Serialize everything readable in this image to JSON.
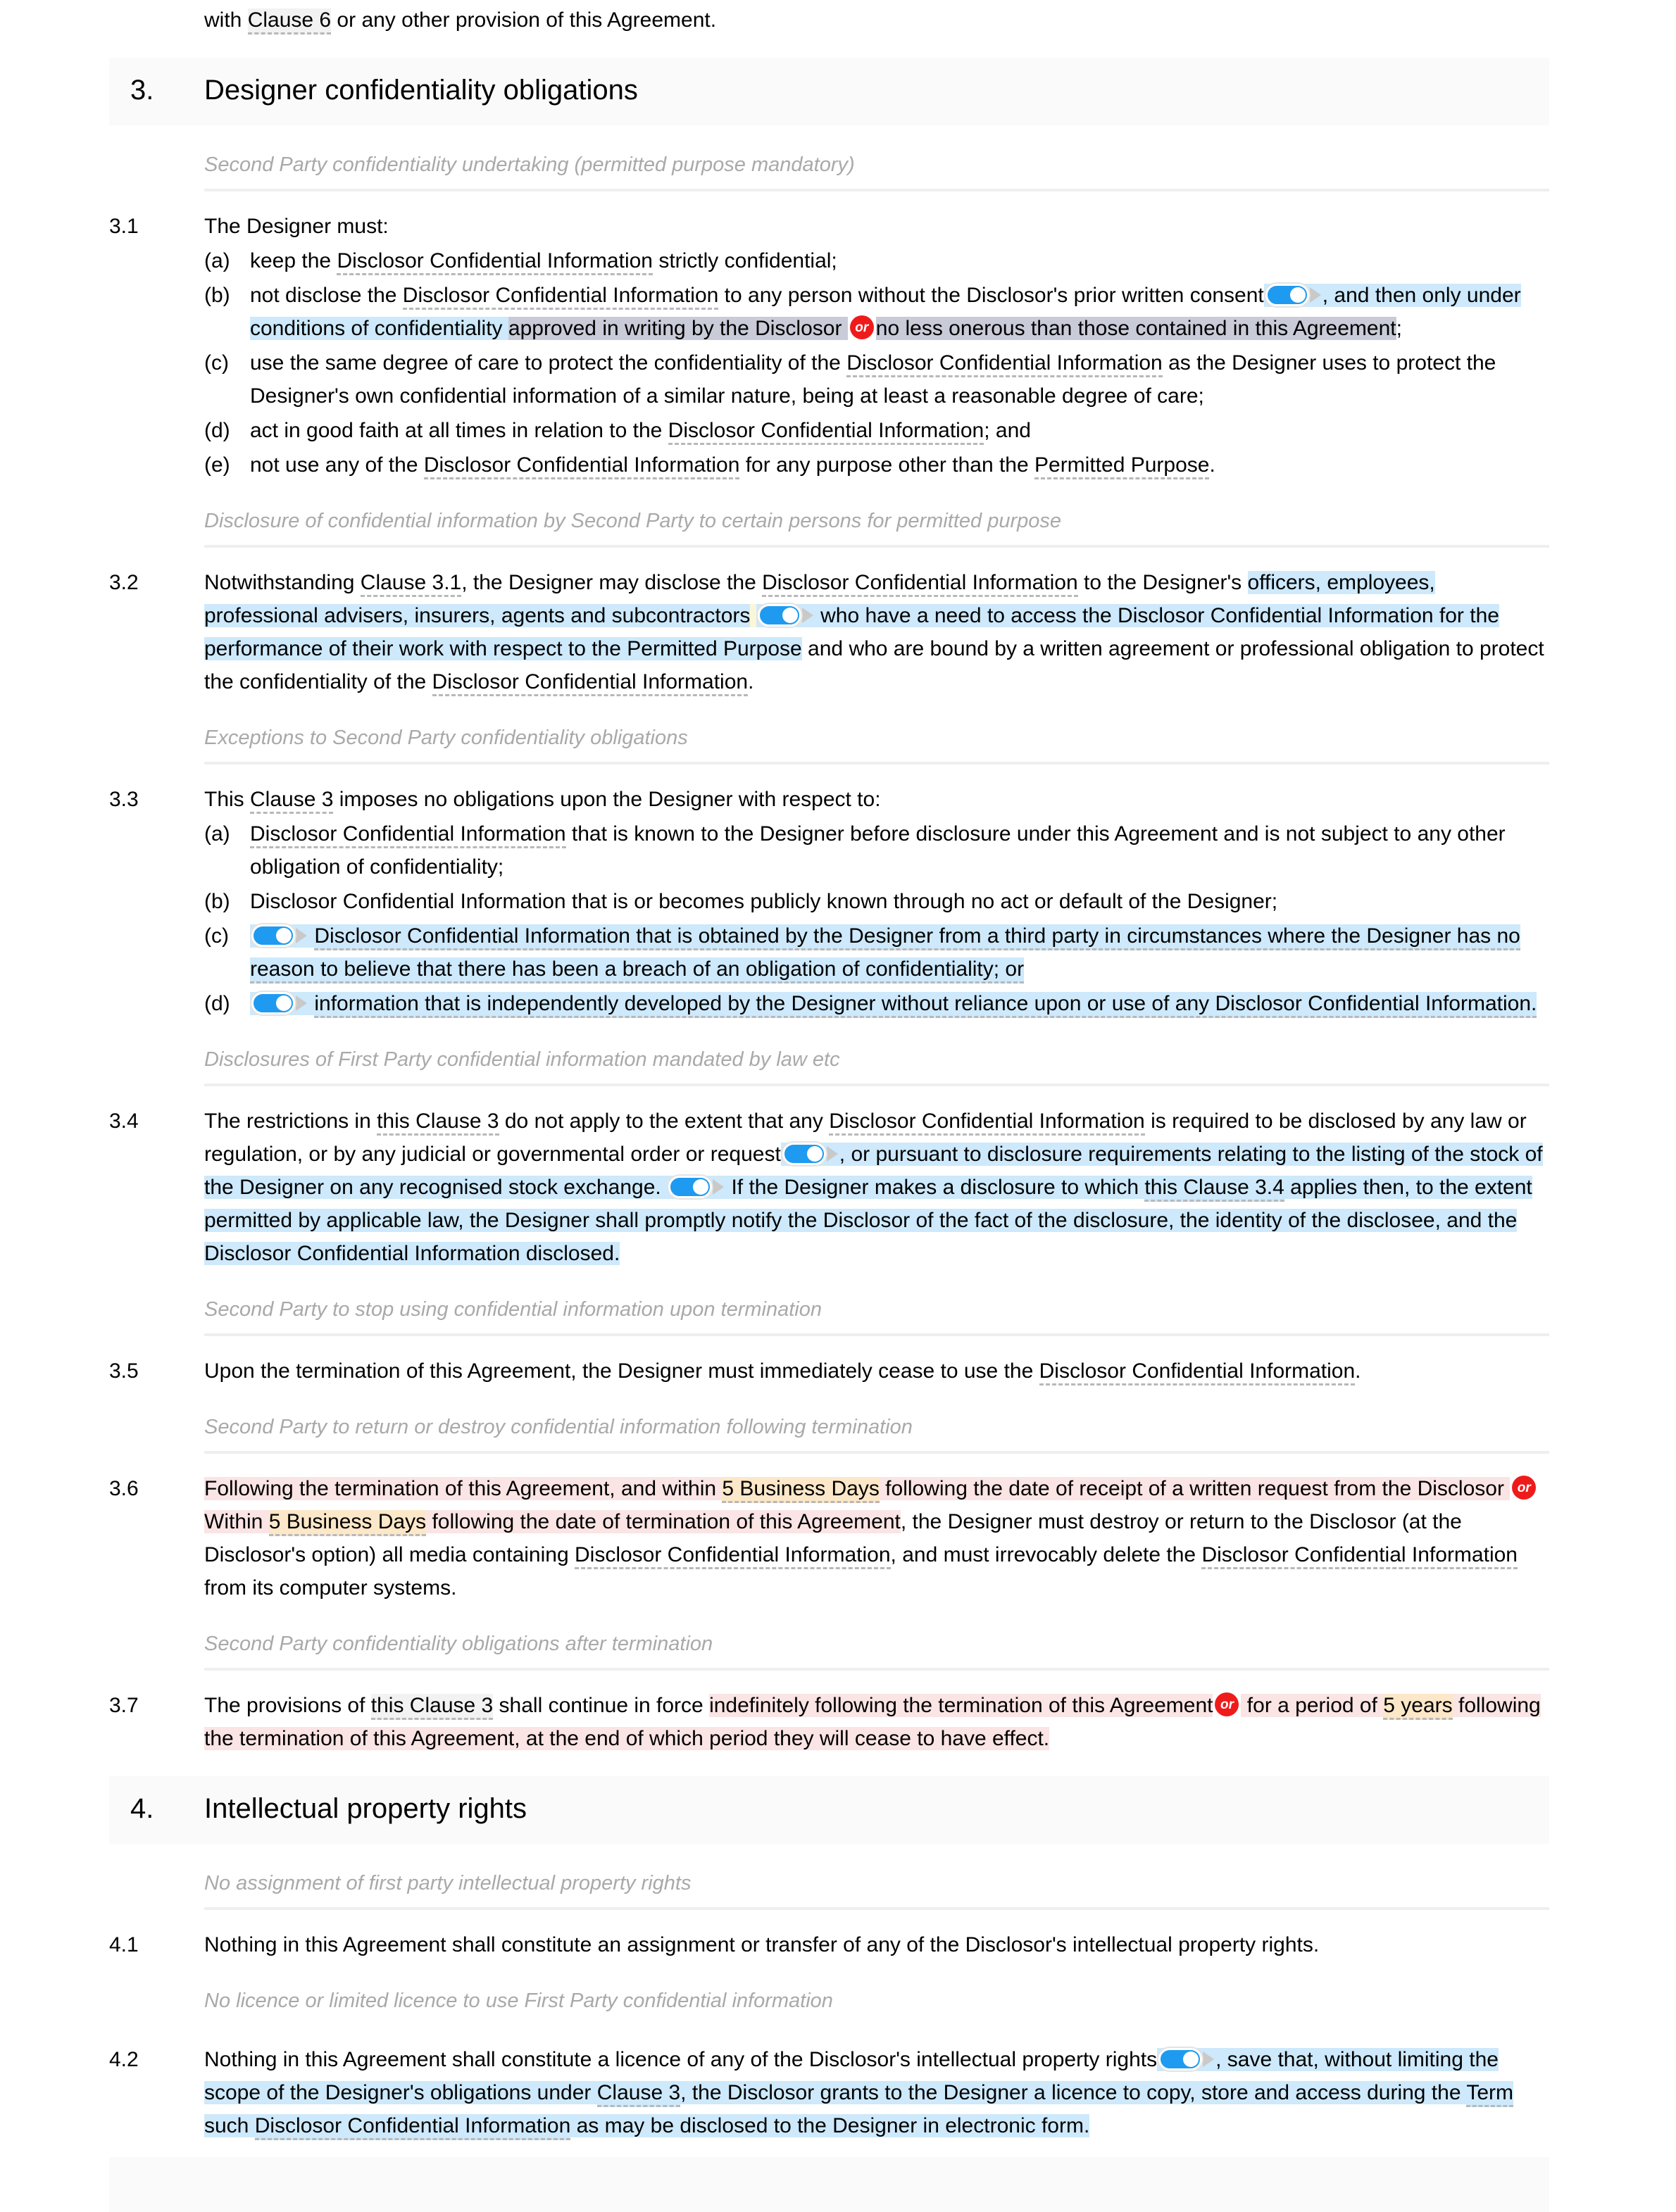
{
  "document": {
    "continued_text_before": "with Clause 6 or any other provision of this Agreement.",
    "continued_term": "Clause 6"
  },
  "colors": {
    "toggle_on": "#1e9bf0",
    "or_badge": "#ef1b1b",
    "highlight_blue": "#cde9fb",
    "highlight_lavender": "#c9cbd8",
    "highlight_grey": "#f2f2f2",
    "highlight_pink": "#fbe4e4",
    "highlight_orange": "#fce7c8",
    "highlight_cream": "#fcf6d8",
    "heading_band": "#fafafa",
    "caption_text": "#a9a9a9",
    "term_underline": "#b8b8b8"
  },
  "icons": {
    "toggle": "toggle-switch-on-icon",
    "or": "or-alternative-badge-icon",
    "triangle": "play-triangle-icon"
  },
  "sections": [
    {
      "number": "3.",
      "title": "Designer confidentiality obligations"
    },
    {
      "number": "4.",
      "title": "Intellectual property rights"
    }
  ],
  "captions": {
    "c31": "Second Party confidentiality undertaking (permitted purpose mandatory)",
    "c32": "Disclosure of confidential information by Second Party to certain persons for permitted purpose",
    "c33": "Exceptions to Second Party confidentiality obligations",
    "c34": "Disclosures of First Party confidential information mandated by law etc",
    "c35": "Second Party to stop using confidential information upon termination",
    "c36": "Second Party to return or destroy confidential information following termination",
    "c37": "Second Party confidentiality obligations after termination",
    "c41": "No assignment of first party intellectual property rights",
    "c42": "No licence or limited licence to use First Party confidential information"
  },
  "clauses": {
    "n31": "3.1",
    "n32": "3.2",
    "n33": "3.3",
    "n34": "3.4",
    "n35": "3.5",
    "n36": "3.6",
    "n37": "3.7",
    "n41": "4.1",
    "n42": "4.2"
  },
  "letters": {
    "a": "(a)",
    "b": "(b)",
    "c": "(c)",
    "d": "(d)",
    "e": "(e)"
  },
  "c31": {
    "lead": "The Designer must:",
    "a": "keep the Disclosor Confidential Information strictly confidential;",
    "a_term": "Disclosor Confidential Information",
    "b_1": "not disclose the ",
    "b_term1": "Disclosor Confidential Information",
    "b_2": " to any person without the Disclosor's prior written consent",
    "b_3": ", and then only under conditions of confidentiality ",
    "b_4": "approved in writing by the Disclosor ",
    "b_5": "no less onerous than those contained in this Agreement",
    "b_6": ";",
    "c_1": "use the same degree of care to protect the confidentiality of the ",
    "c_term": "Disclosor Confidential Information",
    "c_2": " as the Designer uses to protect the Designer's own confidential information of a similar nature, being at least a reasonable degree of care;",
    "d_1": "act in good faith at all times in relation to the ",
    "d_term": "Disclosor Confidential Information",
    "d_2": "; and",
    "e_1": "not use any of the ",
    "e_term": "Disclosor Confidential Information",
    "e_2": " for any purpose other than the ",
    "e_term2": "Permitted Purpose",
    "e_3": "."
  },
  "c32": {
    "t1": "Notwithstanding ",
    "term_clause": "Clause 3.1",
    "t2": ", the Designer may disclose the ",
    "term_dci": "Disclosor Confidential Information",
    "t3": " to the Designer's ",
    "hl1": "officers, employees, professional advisers, insurers, agents and subcontractors",
    "hl2": "who have a need to access the Disclosor Confidential Information for the performance of their work with respect to the Permitted Purpose",
    "t4": " and who are bound by a written agreement or professional obligation to protect the confidentiality of the ",
    "term_dci2": "Disclosor Confidential Information",
    "t5": "."
  },
  "c33": {
    "lead_1": "This ",
    "lead_term": "Clause 3",
    "lead_2": " imposes no obligations upon the Designer with respect to:",
    "a_term": "Disclosor Confidential Information",
    "a_2": " that is known to the Designer before disclosure under this Agreement and is not subject to any other obligation of confidentiality;",
    "b_term": "Disclosor Confidential Information",
    "b_2": " that is or becomes publicly known through no act or default of the Designer;",
    "c_text": "Disclosor Confidential Information that is obtained by the Designer from a third party in circumstances where the Designer has no reason to believe that there has been a breach of an obligation of confidentiality; or",
    "d_text": "information that is independently developed by the Designer without reliance upon or use of any Disclosor Confidential Information."
  },
  "c34": {
    "t1": "The restrictions in ",
    "term_clause3": "this Clause 3",
    "t2": " do not apply to the extent that any ",
    "term_dci": "Disclosor Confidential Information",
    "t3": " is required to be disclosed by any law or regulation, or by any judicial or governmental order or request",
    "t4": ", or pursuant to disclosure requirements relating to the listing of the stock of the Designer on any recognised stock exchange.",
    "t5": "If the Designer makes a disclosure to which ",
    "term_clause34": "this Clause 3.4",
    "t6": " applies then, to the extent permitted by applicable law, the Designer shall promptly notify the Disclosor of the fact of the disclosure, the identity of the disclosee, and the Disclosor Confidential Information disclosed."
  },
  "c35": {
    "t1": "Upon the termination of this Agreement, the Designer must immediately cease to use the ",
    "term_dci": "Disclosor Confidential Information",
    "t2": "."
  },
  "c36": {
    "t1": "Following the termination of this Agreement, and within ",
    "days1": "5 Business Days",
    "t2": " following the date of receipt of a written request from the Disclosor ",
    "t3": "Within ",
    "days2": "5 Business Days",
    "t4": " following the date of termination of this Agreement",
    "t5": ", the Designer must destroy or return to the Disclosor (at the Disclosor's option) all media containing ",
    "term_dci": "Disclosor Confidential Information",
    "t6": ", and must irrevocably delete the ",
    "term_dci2": "Disclosor Confidential Information",
    "t7": " from its computer systems."
  },
  "c37": {
    "t1": "The provisions of ",
    "term_clause3": "this Clause 3",
    "t2": " shall continue in force ",
    "hl_indef": "indefinitely following the termination of this Agreement",
    "t3": " for a period of ",
    "years": "5 years",
    "t4": " following the termination of this Agreement, at the end of which period they will cease to have effect."
  },
  "c41": {
    "t1": "Nothing in this Agreement shall constitute an assignment or transfer of any of the Disclosor's intellectual property rights."
  },
  "c42": {
    "t1": "Nothing in this Agreement shall constitute a licence of any of the Disclosor's intellectual property rights",
    "t2": ", save that, without limiting the scope of the Designer's obligations under ",
    "term_clause3": "Clause 3",
    "t3": ", the Disclosor grants to the Designer a licence to copy, store and access during the ",
    "term_term": "Term",
    "t4": " such ",
    "term_dci": "Disclosor Confidential Information",
    "t5": " as may be disclosed to the Designer in electronic form."
  },
  "or_label": "or"
}
